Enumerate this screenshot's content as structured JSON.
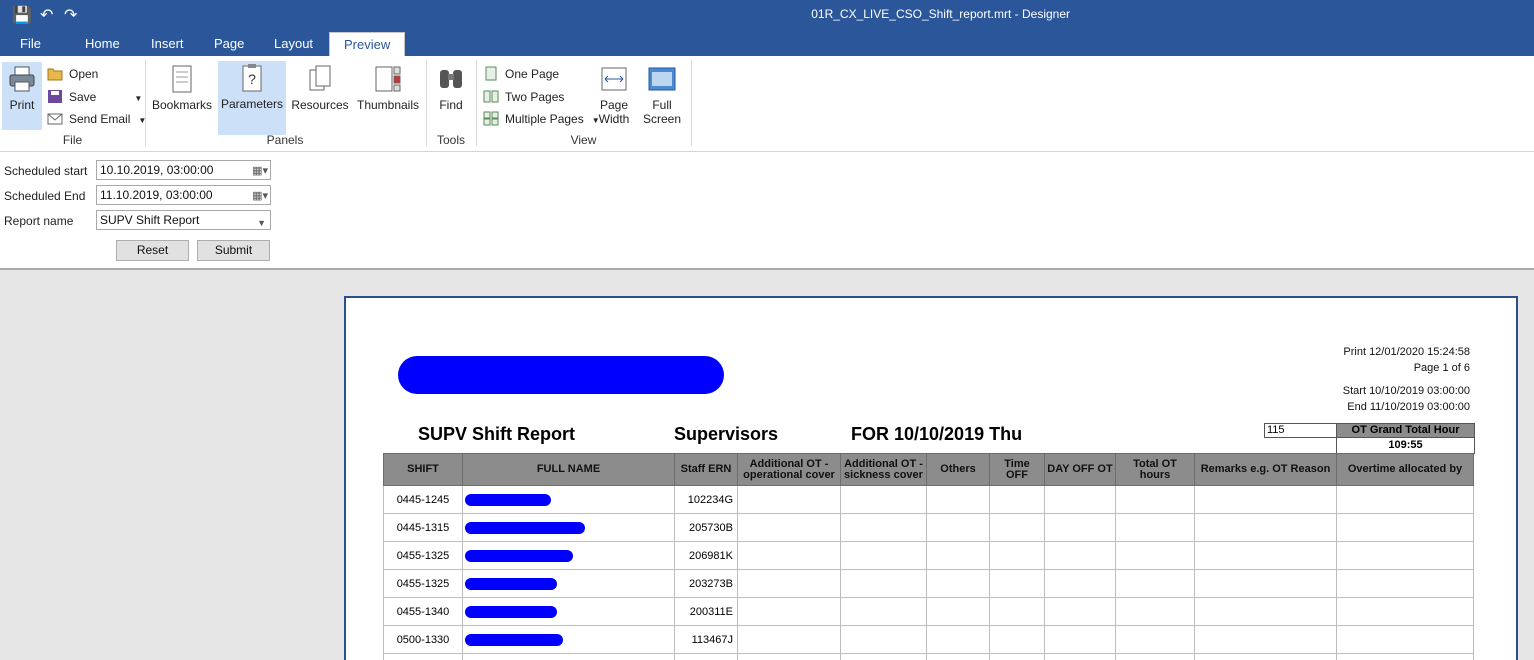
{
  "window": {
    "title": "01R_CX_LIVE_CSO_Shift_report.mrt - Designer"
  },
  "tabs": [
    "File",
    "Home",
    "Insert",
    "Page",
    "Layout",
    "Preview"
  ],
  "ribbon": {
    "file_group": {
      "print": "Print",
      "open": "Open",
      "save": "Save",
      "send_email": "Send Email",
      "label": "File"
    },
    "panels_group": {
      "bookmarks": "Bookmarks",
      "parameters": "Parameters",
      "resources": "Resources",
      "thumbnails": "Thumbnails",
      "label": "Panels"
    },
    "tools_group": {
      "find": "Find",
      "label": "Tools"
    },
    "view_group": {
      "one_page": "One Page",
      "two_pages": "Two Pages",
      "multiple_pages": "Multiple Pages",
      "page_width_1": "Page",
      "page_width_2": "Width",
      "full_screen_1": "Full",
      "full_screen_2": "Screen",
      "label": "View"
    }
  },
  "params": {
    "scheduled_start_label": "Scheduled start",
    "scheduled_start_value": "10.10.2019, 03:00:00",
    "scheduled_end_label": "Scheduled End",
    "scheduled_end_value": "11.10.2019, 03:00:00",
    "report_name_label": "Report name",
    "report_name_value": "SUPV Shift Report",
    "reset": "Reset",
    "submit": "Submit"
  },
  "report": {
    "print_line": "Print 12/01/2020 15:24:58",
    "page_line": "Page 1 of 6",
    "start_line": "Start 10/10/2019 03:00:00",
    "end_line": "End 11/10/2019 03:00:00",
    "title": "SUPV Shift Report",
    "group": "Supervisors",
    "for_line": "FOR 10/10/2019 Thu",
    "ot_count": "115",
    "ot_grand_total_label": "OT Grand Total Hour",
    "ot_grand_total_value": "109:55",
    "columns": [
      "SHIFT",
      "FULL NAME",
      "Staff ERN",
      "Additional OT - operational cover",
      "Additional OT - sickness cover",
      "Others",
      "Time OFF",
      "DAY OFF OT",
      "Total OT hours",
      "Remarks e.g. OT Reason",
      "Overtime allocated by"
    ],
    "rows": [
      {
        "shift": "0445-1245",
        "ern": "102234G"
      },
      {
        "shift": "0445-1315",
        "ern": "205730B"
      },
      {
        "shift": "0455-1325",
        "ern": "206981K"
      },
      {
        "shift": "0455-1325",
        "ern": "203273B"
      },
      {
        "shift": "0455-1340",
        "ern": "200311E"
      },
      {
        "shift": "0500-1330",
        "ern": "113467J"
      }
    ]
  }
}
